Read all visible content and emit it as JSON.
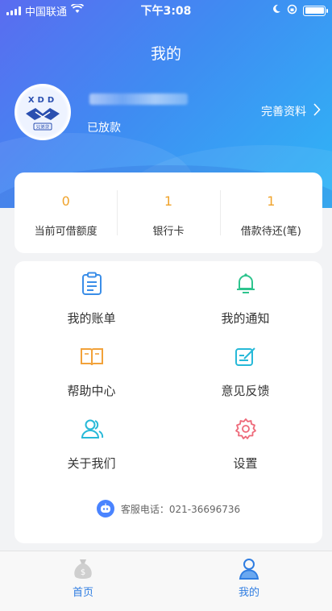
{
  "status_bar": {
    "carrier": "中国联通",
    "time": "下午3:08"
  },
  "header": {
    "title": "我的",
    "loan_status": "已放款",
    "complete_profile": "完善资料",
    "avatar_logo_text": "XDD",
    "avatar_caption": "兄弟贷"
  },
  "stats": [
    {
      "value": "0",
      "label": "当前可借额度"
    },
    {
      "value": "1",
      "label": "银行卡"
    },
    {
      "value": "1",
      "label": "借款待还(笔)"
    }
  ],
  "menu": {
    "items": [
      {
        "label": "我的账单",
        "icon": "bill-icon"
      },
      {
        "label": "我的通知",
        "icon": "bell-icon"
      },
      {
        "label": "帮助中心",
        "icon": "book-icon"
      },
      {
        "label": "意见反馈",
        "icon": "feedback-icon"
      },
      {
        "label": "关于我们",
        "icon": "users-icon"
      },
      {
        "label": "设置",
        "icon": "gear-icon"
      }
    ],
    "hotline": "客服电话：021-36696736"
  },
  "tabbar": {
    "tabs": [
      {
        "label": "首页",
        "icon": "money-bag-icon"
      },
      {
        "label": "我的",
        "icon": "person-icon"
      }
    ]
  },
  "colors": {
    "accent_orange": "#f0a32b",
    "tab_active": "#2f7de1",
    "header_gradient_start": "#5a6cf0",
    "header_gradient_end": "#2fb6f6"
  }
}
